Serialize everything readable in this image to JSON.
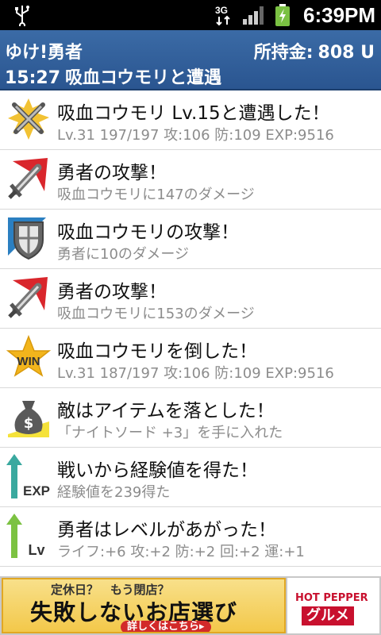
{
  "statusbar": {
    "time": "6:39PM",
    "network": "3G"
  },
  "header": {
    "player_name": "ゆけ!勇者",
    "gold_label": "所持金:",
    "gold_value": "808 U",
    "event_time": "15:27",
    "event_title": "吸血コウモリと遭遇"
  },
  "log": [
    {
      "icon": "crossed-swords-icon",
      "title": "吸血コウモリ Lv.15と遭遇した！",
      "detail": "Lv.31 197/197 攻:106 防:109 EXP:9516"
    },
    {
      "icon": "sword-attack-icon",
      "title": "勇者の攻撃！",
      "detail": "吸血コウモリに147のダメージ"
    },
    {
      "icon": "shield-icon",
      "title": "吸血コウモリの攻撃！",
      "detail": "勇者に10のダメージ"
    },
    {
      "icon": "sword-attack-icon",
      "title": "勇者の攻撃！",
      "detail": "吸血コウモリに153のダメージ"
    },
    {
      "icon": "win-star-icon",
      "title": "吸血コウモリを倒した！",
      "detail": "Lv.31 187/197 攻:106 防:109 EXP:9516",
      "badge": "WIN"
    },
    {
      "icon": "money-bag-icon",
      "title": "敵はアイテムを落とした！",
      "detail": "「ナイトソード +3」を手に入れた"
    },
    {
      "icon": "exp-arrow-icon",
      "title": "戦いから経験値を得た！",
      "detail": "経験値を239得た",
      "badge": "EXP"
    },
    {
      "icon": "level-up-arrow-icon",
      "title": "勇者はレベルがあがった！",
      "detail": "ライフ:+6 攻:+2 防:+2 回:+2 運:+1",
      "badge": "Lv"
    }
  ],
  "ad": {
    "small_text": "定休日？　もう閉店？",
    "big_text": "失敗しないお店選び",
    "cta": "詳しくはこちら▸",
    "brand_top": "HOT PEPPER",
    "brand_bottom": "グルメ"
  },
  "colors": {
    "header_bg": "#2f5e98",
    "detail_text": "#8c8c8c",
    "sword_red": "#d9262c",
    "shield_blue": "#2b7fc1",
    "exp_teal": "#3aa99f",
    "lv_green": "#7cc242",
    "star_gold": "#f2b51c"
  }
}
